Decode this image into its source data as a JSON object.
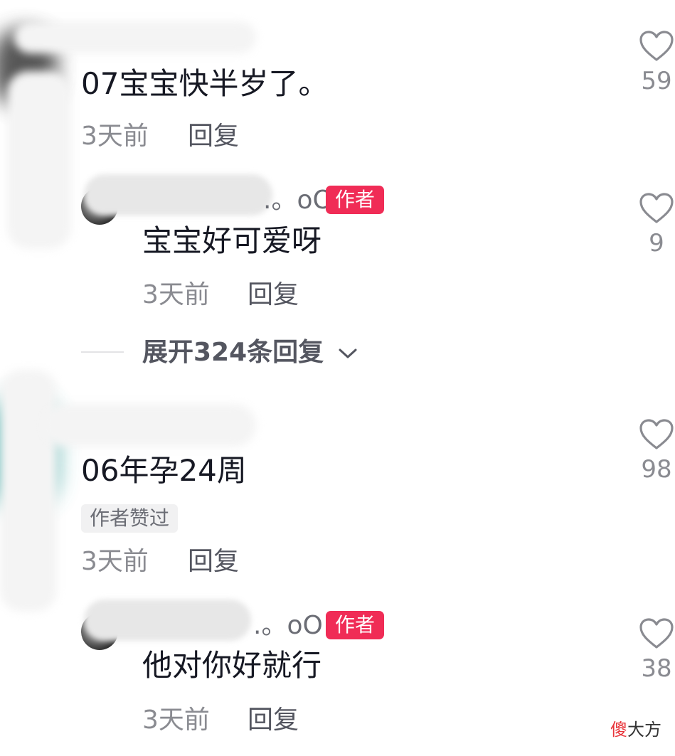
{
  "comments": [
    {
      "text": "07宝宝快半岁了。",
      "time": "3天前",
      "reply_label": "回复",
      "like_count": "59",
      "replies": [
        {
          "name_suffix": ".。oO",
          "author_badge": "作者",
          "text": "宝宝好可爱呀",
          "time": "3天前",
          "reply_label": "回复",
          "like_count": "9"
        }
      ],
      "expand_label": "展开324条回复"
    },
    {
      "text": "06年孕24周",
      "liked_badge": "作者赞过",
      "time": "3天前",
      "reply_label": "回复",
      "like_count": "98",
      "replies": [
        {
          "name_suffix": ".。oO",
          "author_badge": "作者",
          "text": "他对你好就行",
          "time": "3天前",
          "reply_label": "回复",
          "like_count": "38"
        }
      ]
    }
  ],
  "watermark": {
    "highlight": "傻",
    "rest": "大方"
  },
  "colors": {
    "author_badge": "#f02c56",
    "text_primary": "#161823",
    "text_secondary": "#8a8b91"
  }
}
